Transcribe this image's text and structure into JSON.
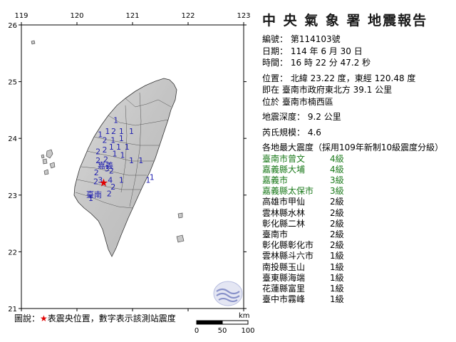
{
  "map": {
    "lon_ticks": [
      "119",
      "120",
      "121",
      "122",
      "123"
    ],
    "lat_ticks": [
      "26",
      "25",
      "24",
      "23",
      "22",
      "21"
    ],
    "lon_range": [
      119,
      123
    ],
    "lat_range": [
      21,
      26
    ],
    "epicenter": {
      "lon": 120.48,
      "lat": 23.22
    },
    "city_labels": [
      "嘉義",
      "臺南"
    ],
    "scale_bar": {
      "unit": "km",
      "labels": [
        "0",
        "50",
        "100"
      ]
    },
    "stations": [
      {
        "v": "1",
        "lon": 120.7,
        "lat": 24.27
      },
      {
        "v": "1",
        "lon": 120.55,
        "lat": 24.08
      },
      {
        "v": "2",
        "lon": 120.66,
        "lat": 24.08
      },
      {
        "v": "1",
        "lon": 120.8,
        "lat": 24.08
      },
      {
        "v": "1",
        "lon": 120.98,
        "lat": 24.08
      },
      {
        "v": "1",
        "lon": 120.42,
        "lat": 24.02
      },
      {
        "v": "2",
        "lon": 120.5,
        "lat": 23.92
      },
      {
        "v": "1",
        "lon": 120.65,
        "lat": 23.92
      },
      {
        "v": "1",
        "lon": 120.8,
        "lat": 23.95
      },
      {
        "v": "1",
        "lon": 120.62,
        "lat": 23.8
      },
      {
        "v": "1",
        "lon": 120.75,
        "lat": 23.8
      },
      {
        "v": "1",
        "lon": 120.9,
        "lat": 23.8
      },
      {
        "v": "2",
        "lon": 120.38,
        "lat": 23.72
      },
      {
        "v": "2",
        "lon": 120.5,
        "lat": 23.75
      },
      {
        "v": "1",
        "lon": 120.68,
        "lat": 23.68
      },
      {
        "v": "1",
        "lon": 120.82,
        "lat": 23.66
      },
      {
        "v": "2",
        "lon": 120.38,
        "lat": 23.56
      },
      {
        "v": "2",
        "lon": 120.52,
        "lat": 23.58
      },
      {
        "v": "1",
        "lon": 120.98,
        "lat": 23.56
      },
      {
        "v": "1",
        "lon": 121.15,
        "lat": 23.56
      },
      {
        "v": "3",
        "lon": 120.54,
        "lat": 23.42
      },
      {
        "v": "2",
        "lon": 120.62,
        "lat": 23.38
      },
      {
        "v": "2",
        "lon": 120.35,
        "lat": 23.35
      },
      {
        "v": "3",
        "lon": 120.42,
        "lat": 23.22
      },
      {
        "v": "4",
        "lon": 120.6,
        "lat": 23.22
      },
      {
        "v": "1",
        "lon": 120.8,
        "lat": 23.22
      },
      {
        "v": "1",
        "lon": 121.28,
        "lat": 23.22
      },
      {
        "v": "2",
        "lon": 120.34,
        "lat": 23.19
      },
      {
        "v": "2",
        "lon": 120.65,
        "lat": 23.1
      },
      {
        "v": "2",
        "lon": 120.58,
        "lat": 22.98
      },
      {
        "v": "1",
        "lon": 120.25,
        "lat": 22.9
      },
      {
        "v": "1",
        "lon": 121.35,
        "lat": 23.27
      }
    ]
  },
  "legend": {
    "prefix": "圖說：",
    "star": "★",
    "text": "表震央位置，數字表示該測站震度"
  },
  "report": {
    "title": "中 央 氣 象 署 地震報告",
    "number": "編號： 第114103號",
    "date": "日期： 114 年 6 月 30 日",
    "time": "時間： 16 時 22 分 47.2 秒",
    "position": "位置： 北緯 23.22 度，東經 120.48 度",
    "position_ref": "即在 臺南市政府東北方 39.1 公里",
    "located_in": "位於 臺南市楠西區",
    "depth": "地震深度： 9.2 公里",
    "magnitude": "芮氏規模： 4.6",
    "intensity_header": "各地最大震度（採用109年新制10級震度分級）",
    "intensities": [
      {
        "area": "臺南市曾文",
        "level": "4級"
      },
      {
        "area": "嘉義縣大埔",
        "level": "4級"
      },
      {
        "area": "嘉義市",
        "level": "3級"
      },
      {
        "area": "嘉義縣太保市",
        "level": "3級"
      },
      {
        "area": "高雄市甲仙",
        "level": "2級"
      },
      {
        "area": "雲林縣水林",
        "level": "2級"
      },
      {
        "area": "彰化縣二林",
        "level": "2級"
      },
      {
        "area": "臺南市",
        "level": "2級"
      },
      {
        "area": "彰化縣彰化市",
        "level": "2級"
      },
      {
        "area": "雲林縣斗六市",
        "level": "1級"
      },
      {
        "area": "南投縣玉山",
        "level": "1級"
      },
      {
        "area": "臺東縣海端",
        "level": "1級"
      },
      {
        "area": "花蓮縣富里",
        "level": "1級"
      },
      {
        "area": "臺中市霧峰",
        "level": "1級"
      }
    ],
    "green_rows": 4,
    "colors": {
      "felt_green": "#1c7a1c",
      "epicenter_red": "#e00000",
      "station_blue": "#1f1fb0"
    }
  }
}
